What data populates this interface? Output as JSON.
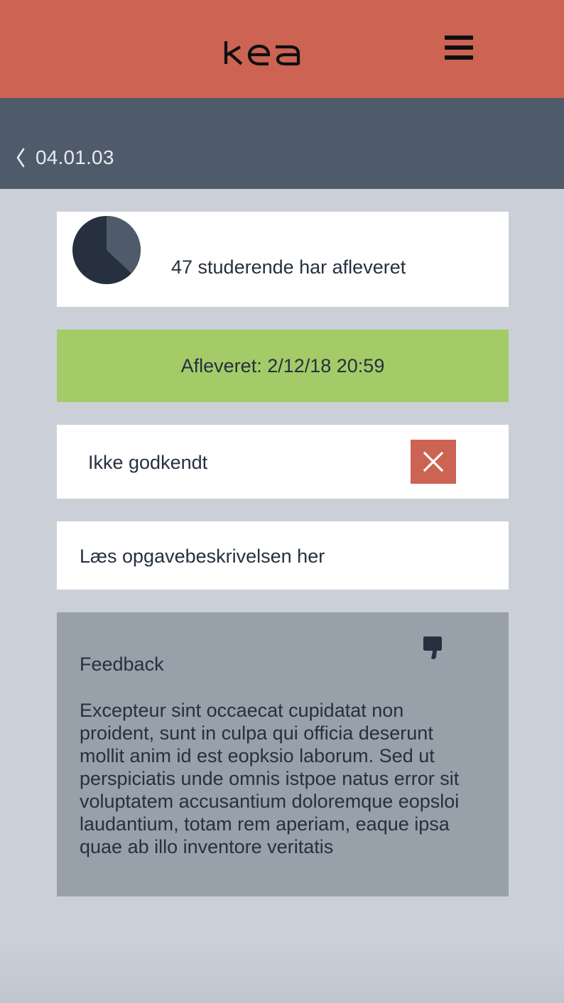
{
  "header": {
    "logo_text": "kea",
    "logo_icon": "kea-logo",
    "menu_icon": "hamburger-menu-icon",
    "brand_color": "#cc6353"
  },
  "nav": {
    "back_icon": "chevron-left-icon",
    "back_label": "04.01.03",
    "bar_color": "#4f5a6a"
  },
  "progress": {
    "text": "47 studerende har afleveret",
    "pie_fraction": 0.37,
    "pie_colors": {
      "filled": "#4f5a6a",
      "rest": "#26303f"
    }
  },
  "submission": {
    "text": "Afleveret: 2/12/18 20:59",
    "color": "#a3cb68"
  },
  "status": {
    "text": "Ikke godkendt",
    "icon": "close-icon",
    "icon_bg": "#cc6353"
  },
  "task": {
    "link_text": "Læs opgavebeskrivelsen her"
  },
  "feedback": {
    "title": "Feedback",
    "icon": "thumbs-down-icon",
    "body": "Excepteur sint occaecat cupidatat non proident, sunt in culpa qui officia deserunt mollit anim id est eopksio laborum. Sed ut perspiciatis unde omnis istpoe natus error sit voluptatem accusantium doloremque eopsloi laudantium, totam rem aperiam, eaque ipsa quae ab illo inventore veritatis"
  }
}
